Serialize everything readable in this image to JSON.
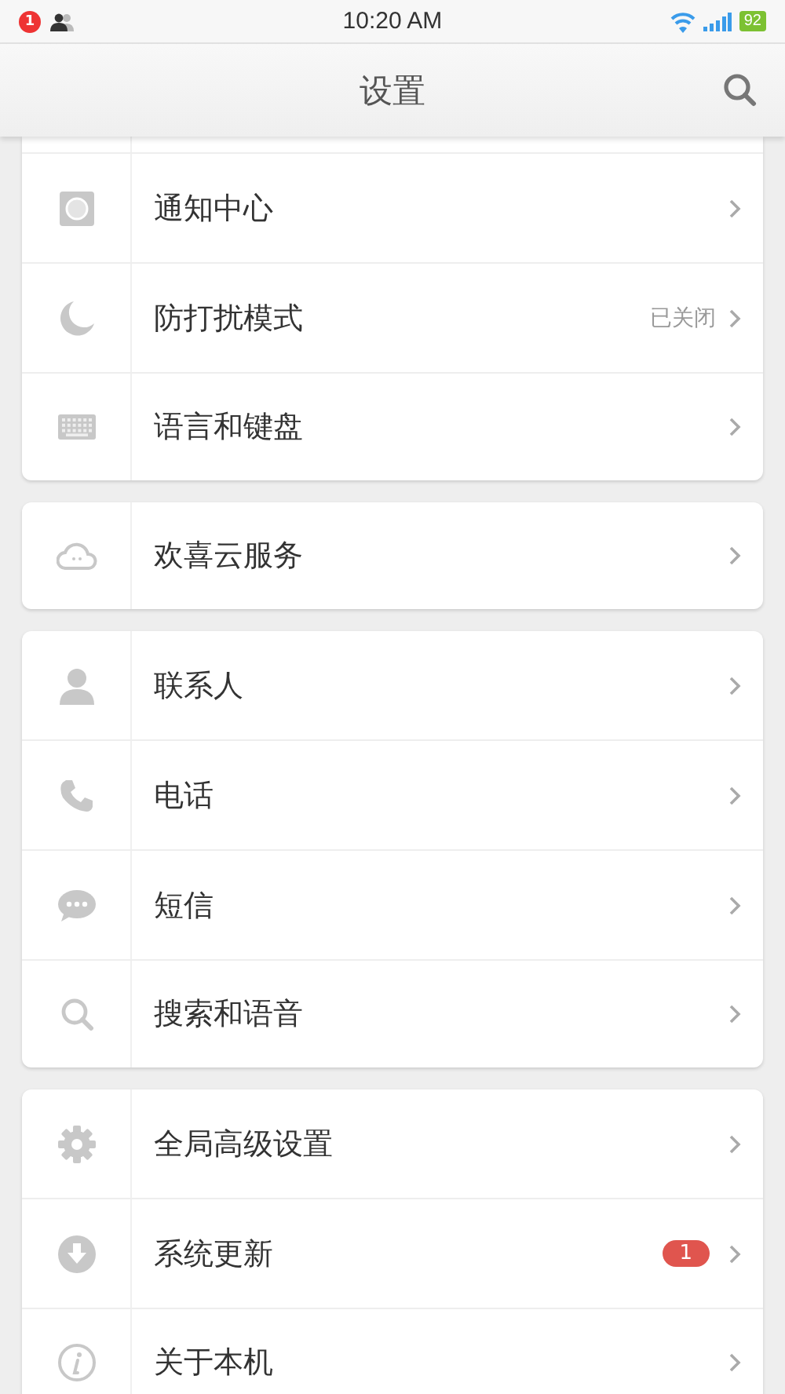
{
  "status_bar": {
    "notification_count": "1",
    "time": "10:20 AM",
    "battery": "92"
  },
  "header": {
    "title": "设置"
  },
  "sections": [
    {
      "items": [
        {
          "kind": "notification",
          "label": "通知中心"
        },
        {
          "kind": "moon",
          "label": "防打扰模式",
          "value": "已关闭"
        },
        {
          "kind": "keyboard",
          "label": "语言和键盘"
        }
      ]
    },
    {
      "items": [
        {
          "kind": "cloud",
          "label": "欢喜云服务"
        }
      ]
    },
    {
      "items": [
        {
          "kind": "person",
          "label": "联系人"
        },
        {
          "kind": "phone",
          "label": "电话"
        },
        {
          "kind": "chat",
          "label": "短信"
        },
        {
          "kind": "search",
          "label": "搜索和语音"
        }
      ]
    },
    {
      "items": [
        {
          "kind": "gear",
          "label": "全局高级设置"
        },
        {
          "kind": "download",
          "label": "系统更新",
          "badge": "1"
        },
        {
          "kind": "info",
          "label": "关于本机"
        }
      ]
    }
  ]
}
